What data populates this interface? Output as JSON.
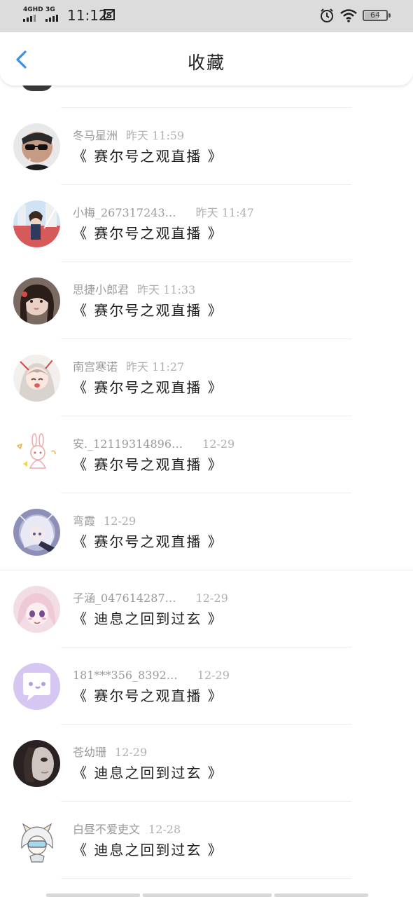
{
  "status_bar": {
    "signal1_label": "4GHD",
    "signal2_label": "3G",
    "time": "11:12",
    "battery": "64",
    "battery_level": 0.64
  },
  "header": {
    "title": "收藏",
    "back_icon": "chevron-left-icon",
    "accent_color": "#3b8fe8"
  },
  "items": [
    {
      "name": "冬马星洲",
      "date": "昨天 11:59",
      "subject": "《 赛尔号之观直播 》"
    },
    {
      "name": "小梅_267317243…",
      "date": "昨天 11:47",
      "subject": "《 赛尔号之观直播 》"
    },
    {
      "name": "思捷小郎君",
      "date": "昨天 11:33",
      "subject": "《 赛尔号之观直播 》"
    },
    {
      "name": "南宫寒诺",
      "date": "昨天 11:27",
      "subject": "《 赛尔号之观直播 》"
    },
    {
      "name": "安._12119314896…",
      "date": "12-29",
      "subject": "《 赛尔号之观直播 》"
    },
    {
      "name": "弯霞",
      "date": "12-29",
      "subject": "《 赛尔号之观直播 》"
    },
    {
      "name": "子涵_047614287…",
      "date": "12-29",
      "subject": "《 迪息之回到过玄 》"
    },
    {
      "name": "181***356_8392…",
      "date": "12-29",
      "subject": "《 赛尔号之观直播 》"
    },
    {
      "name": "苍幼珊",
      "date": "12-29",
      "subject": "《 迪息之回到过玄 》"
    },
    {
      "name": "白昼不爱吏文",
      "date": "12-28",
      "subject": "《 迪息之回到过玄 》"
    }
  ]
}
